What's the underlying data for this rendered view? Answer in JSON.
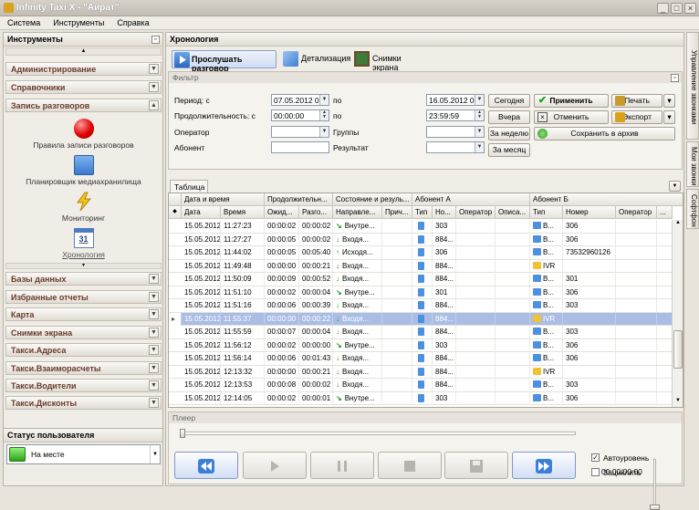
{
  "window": {
    "title": "Infinity Taxi X - \"Айрат\""
  },
  "menu": [
    "Система",
    "Инструменты",
    "Справка"
  ],
  "left": {
    "header": "Инструменты",
    "sections_top": [
      "Администрирование",
      "Справочники"
    ],
    "expanded": "Запись разговоров",
    "tools": [
      "Правила записи разговоров",
      "Планировщик медиахранилища",
      "Мониторинг",
      "Хронология"
    ],
    "sections_bottom": [
      "Базы данных",
      "Избранные отчеты",
      "Карта",
      "Снимки экрана",
      "Такси.Адреса",
      "Такси.Взаиморасчеты",
      "Такси.Водители",
      "Такси.Дисконты"
    ]
  },
  "status": {
    "header": "Статус пользователя",
    "value": "На месте"
  },
  "main": {
    "header": "Хронология",
    "toolbar": [
      "Прослушать разговор",
      "Детализация",
      "Снимки экрана"
    ],
    "filter": {
      "header": "Фильтр",
      "period_label": "Период: с",
      "period_from": "07.05.2012 0:",
      "po": "по",
      "period_to": "16.05.2012 0:",
      "duration_label": "Продолжительность: с",
      "dur_from": "00:00:00",
      "dur_to": "23:59:59",
      "operator_label": "Оператор",
      "groups_label": "Группы",
      "abonent_label": "Абонент",
      "result_label": "Результат",
      "btn_today": "Сегодня",
      "btn_yesterday": "Вчера",
      "btn_week": "За неделю",
      "btn_month": "За месяц",
      "btn_apply": "Применить",
      "btn_cancel": "Отменить",
      "btn_print": "Печать",
      "btn_export": "Экспорт",
      "btn_archive": "Сохранить в архив"
    },
    "table_tab": "Таблица",
    "groups": [
      "Дата и время",
      "Продолжительн...",
      "Состояние и резуль...",
      "Абонент А",
      "Абонент Б"
    ],
    "columns": [
      "Дата",
      "Время",
      "Ожид...",
      "Разго...",
      "Направле...",
      "Прич...",
      "Тип",
      "Но...",
      "Оператор",
      "Описа...",
      "Тип",
      "Номер",
      "Оператор",
      "..."
    ],
    "rows": [
      [
        "15.05.2012",
        "11:27:23",
        "00:00:02",
        "00:00:02",
        "Внутре...",
        "",
        "",
        "303",
        "",
        "",
        "В...",
        "306",
        ""
      ],
      [
        "15.05.2012",
        "11:27:27",
        "00:00:05",
        "00:00:02",
        "Входя...",
        "",
        "",
        "884...",
        "",
        "",
        "В...",
        "306",
        ""
      ],
      [
        "15.05.2012",
        "11:44:02",
        "00:00:05",
        "00:05:40",
        "Исходя...",
        "",
        "",
        "306",
        "",
        "",
        "В...",
        "73532960126",
        ""
      ],
      [
        "15.05.2012",
        "11:49:48",
        "00:00:00",
        "00:00:21",
        "Входя...",
        "",
        "",
        "884...",
        "",
        "",
        "IVR",
        "",
        ""
      ],
      [
        "15.05.2012",
        "11:50:09",
        "00:00:09",
        "00:00:52",
        "Входя...",
        "",
        "",
        "884...",
        "",
        "",
        "В...",
        "301",
        ""
      ],
      [
        "15.05.2012",
        "11:51:10",
        "00:00:02",
        "00:00:04",
        "Внутре...",
        "",
        "",
        "301",
        "",
        "",
        "В...",
        "306",
        ""
      ],
      [
        "15.05.2012",
        "11:51:16",
        "00:00:06",
        "00:00:39",
        "Входя...",
        "",
        "",
        "884...",
        "",
        "",
        "В...",
        "303",
        ""
      ],
      [
        "15.05.2012",
        "11:55:37",
        "00:00:00",
        "00:00:22",
        "Входя...",
        "",
        "",
        "884...",
        "",
        "",
        "IVR",
        "",
        ""
      ],
      [
        "15.05.2012",
        "11:55:59",
        "00:00:07",
        "00:00:04",
        "Входя...",
        "",
        "",
        "884...",
        "",
        "",
        "В...",
        "303",
        ""
      ],
      [
        "15.05.2012",
        "11:56:12",
        "00:00:02",
        "00:00:00",
        "Внутре...",
        "",
        "",
        "303",
        "",
        "",
        "В...",
        "306",
        ""
      ],
      [
        "15.05.2012",
        "11:56:14",
        "00:00:06",
        "00:01:43",
        "Входя...",
        "",
        "",
        "884...",
        "",
        "",
        "В...",
        "306",
        ""
      ],
      [
        "15.05.2012",
        "12:13:32",
        "00:00:00",
        "00:00:21",
        "Входя...",
        "",
        "",
        "884...",
        "",
        "",
        "IVR",
        "",
        ""
      ],
      [
        "15.05.2012",
        "12:13:53",
        "00:00:08",
        "00:00:02",
        "Входя...",
        "",
        "",
        "884...",
        "",
        "",
        "В...",
        "303",
        ""
      ],
      [
        "15.05.2012",
        "12:14:05",
        "00:00:02",
        "00:00:01",
        "Внутре...",
        "",
        "",
        "303",
        "",
        "",
        "В...",
        "306",
        ""
      ]
    ],
    "selected_row": 7,
    "player": {
      "header": "Плеер",
      "time": "00:00/00:00",
      "auto_level": "Автоуровень",
      "loop": "Зациклить"
    }
  },
  "side_tabs": [
    "Управление звонками",
    "Мои звонки",
    "Софтфон"
  ]
}
